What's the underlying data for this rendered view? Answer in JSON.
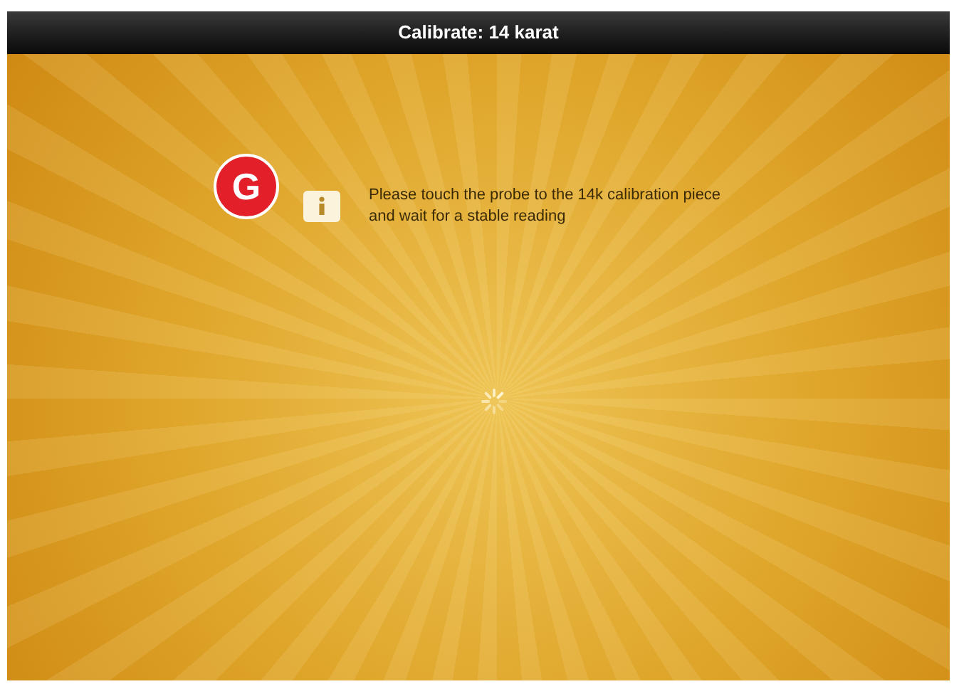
{
  "window": {
    "title": "Calibrate: 14 karat"
  },
  "callout": {
    "label": "G"
  },
  "message": {
    "text": "Please touch the probe to the 14k calibration piece and wait for a stable reading"
  }
}
